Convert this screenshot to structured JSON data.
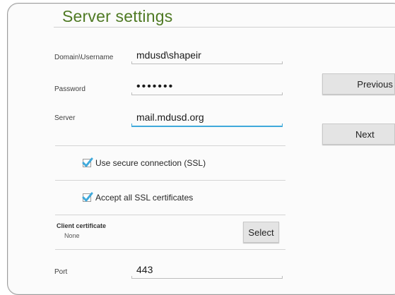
{
  "title": "Server settings",
  "fields": {
    "username": {
      "label": "Domain\\Username",
      "value": "mdusd\\shapeir"
    },
    "password": {
      "label": "Password",
      "value": "•••••••"
    },
    "server": {
      "label": "Server",
      "value": "mail.mdusd.org"
    },
    "port": {
      "label": "Port",
      "value": "443"
    }
  },
  "options": {
    "ssl": {
      "label": "Use secure connection (SSL)",
      "checked": true
    },
    "accept_all": {
      "label": "Accept all SSL certificates",
      "checked": true
    }
  },
  "client_certificate": {
    "title": "Client certificate",
    "value": "None",
    "select_label": "Select"
  },
  "buttons": {
    "previous": "Previous",
    "next": "Next"
  },
  "colors": {
    "title": "#4f7a24",
    "focus": "#3fa9db",
    "check": "#3fa9db"
  }
}
